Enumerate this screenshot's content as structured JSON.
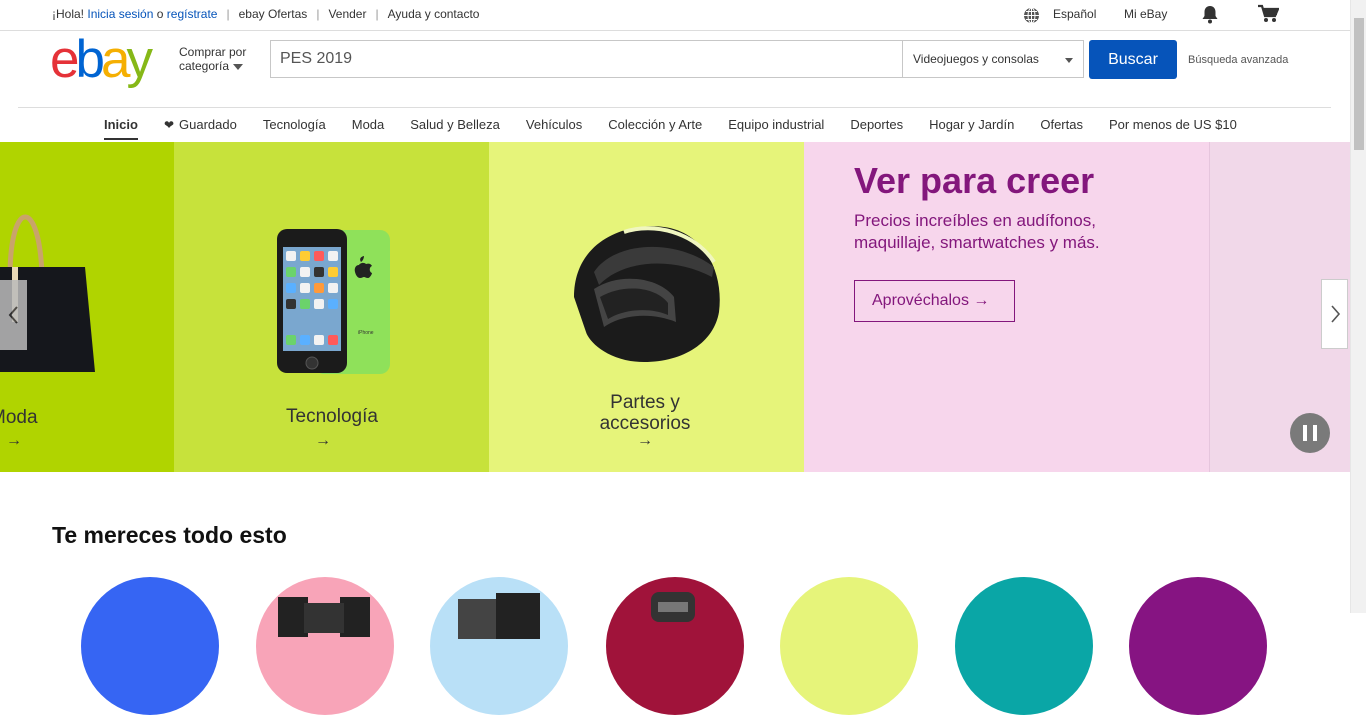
{
  "topbar": {
    "greeting": "¡Hola!",
    "signin": "Inicia sesión",
    "or": "o",
    "register": "regístrate",
    "links": [
      "ebay Ofertas",
      "Vender",
      "Ayuda y contacto"
    ],
    "language": "Español",
    "my_ebay": "Mi eBay",
    "icons": [
      "globe-icon",
      "bell-icon",
      "cart-icon"
    ]
  },
  "header": {
    "logo": {
      "e": "e",
      "b": "b",
      "a": "a",
      "y": "y"
    },
    "shop_by_category_line1": "Comprar por",
    "shop_by_category_line2": "categoría",
    "search_value": "PES 2019",
    "category_select": "Videojuegos y consolas",
    "search_button": "Buscar",
    "advanced_search": "Búsqueda avanzada"
  },
  "nav": {
    "items": [
      "Inicio",
      "Guardado",
      "Tecnología",
      "Moda",
      "Salud y Belleza",
      "Vehículos",
      "Colección y Arte",
      "Equipo industrial",
      "Deportes",
      "Hogar y Jardín",
      "Ofertas",
      "Por menos de US $10"
    ],
    "active_index": 0
  },
  "hero": {
    "panels": [
      {
        "label": "Moda",
        "arrow": "→",
        "color": "#b0d400"
      },
      {
        "label": "Tecnología",
        "arrow": "→",
        "color": "#c7e23b"
      },
      {
        "label_line1": "Partes y",
        "label_line2": "accesorios",
        "arrow": "→",
        "color": "#e6f47a"
      }
    ],
    "title": "Ver para creer",
    "subtitle": "Precios increíbles en audífonos, maquillaje, smartwatches y más.",
    "cta": "Aprovéchalos →",
    "accent": "#83177c",
    "promo_bg": "#f7d6ec"
  },
  "section": {
    "title": "Te mereces todo esto",
    "circle_colors": [
      "#3665f3",
      "#f8a4b8",
      "#b9e0f7",
      "#a0133a",
      "#e6f47a",
      "#0aa6a6",
      "#861482"
    ]
  },
  "phone_brand": "iPhone"
}
